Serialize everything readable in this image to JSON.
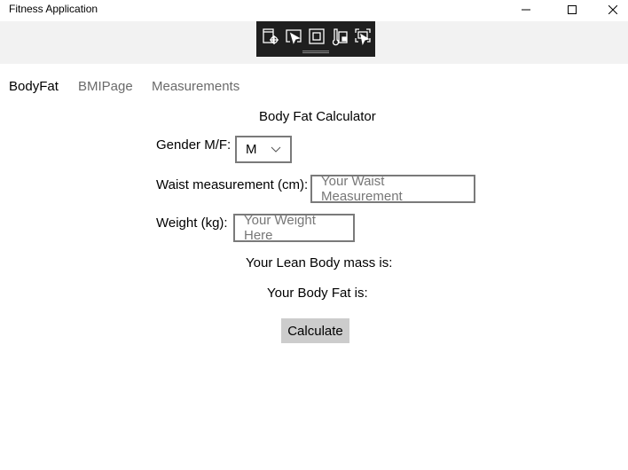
{
  "window": {
    "title": "Fitness Application",
    "minimize": "—",
    "maximize": "☐",
    "close": "✕"
  },
  "tabs": [
    {
      "label": "BodyFat",
      "selected": true
    },
    {
      "label": "BMIPage"
    },
    {
      "label": "Measurements"
    }
  ],
  "form": {
    "heading": "Body Fat Calculator",
    "gender_label": "Gender M/F:",
    "gender_value": "M",
    "waist_label": "Waist measurement (cm):",
    "waist_placeholder": "Your Waist Measurement",
    "weight_label": "Weight (kg):",
    "weight_placeholder": "Your Weight Here",
    "lean_mass_label": "Your Lean Body mass is:",
    "body_fat_label": "Your Body Fat is:",
    "calculate": "Calculate"
  }
}
